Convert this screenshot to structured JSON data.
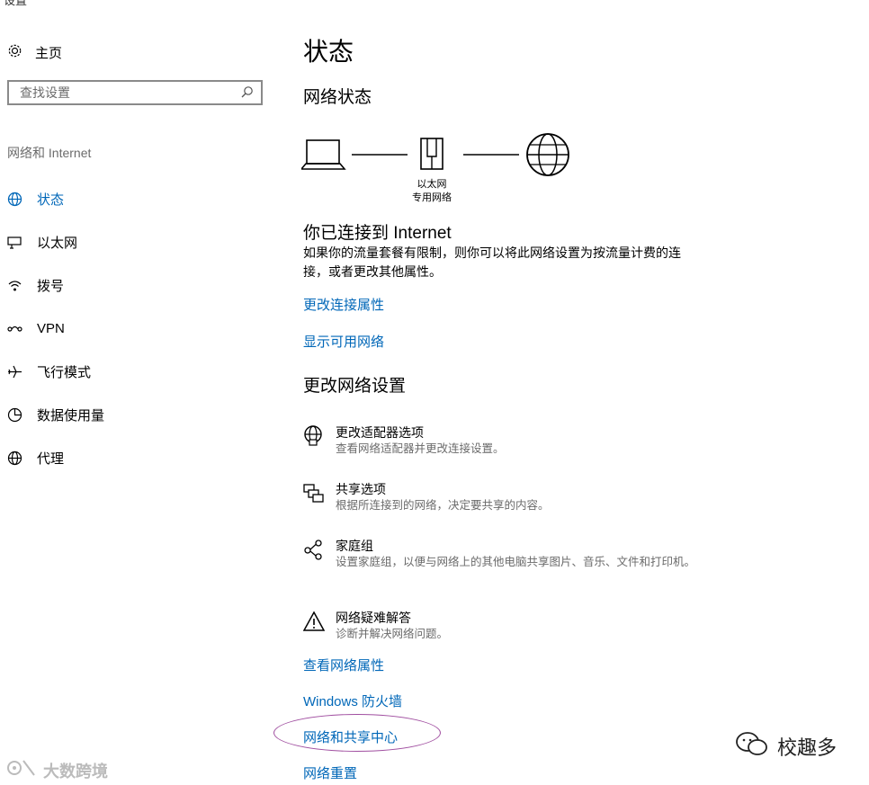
{
  "window": {
    "title": "设置"
  },
  "sidebar": {
    "home_label": "主页",
    "search_placeholder": "查找设置",
    "section_label": "网络和 Internet",
    "items": [
      {
        "label": "状态",
        "icon": "globe-status-icon",
        "active": true
      },
      {
        "label": "以太网",
        "icon": "ethernet-icon"
      },
      {
        "label": "拨号",
        "icon": "dialup-icon"
      },
      {
        "label": "VPN",
        "icon": "vpn-icon"
      },
      {
        "label": "飞行模式",
        "icon": "airplane-icon"
      },
      {
        "label": "数据使用量",
        "icon": "data-usage-icon"
      },
      {
        "label": "代理",
        "icon": "proxy-globe-icon"
      }
    ]
  },
  "main": {
    "title": "状态",
    "network_status_heading": "网络状态",
    "diagram": {
      "adapter_line1": "以太网",
      "adapter_line2": "专用网络"
    },
    "connected_heading": "你已连接到 Internet",
    "connected_desc": "如果你的流量套餐有限制，则你可以将此网络设置为按流量计费的连接，或者更改其他属性。",
    "links_top": [
      "更改连接属性",
      "显示可用网络"
    ],
    "change_heading": "更改网络设置",
    "options": [
      {
        "title": "更改适配器选项",
        "desc": "查看网络适配器并更改连接设置。",
        "icon": "adapter-icon"
      },
      {
        "title": "共享选项",
        "desc": "根据所连接到的网络，决定要共享的内容。",
        "icon": "sharing-icon"
      },
      {
        "title": "家庭组",
        "desc": "设置家庭组，以便与网络上的其他电脑共享图片、音乐、文件和打印机。",
        "icon": "homegroup-icon"
      },
      {
        "title": "网络疑难解答",
        "desc": "诊断并解决网络问题。",
        "icon": "warning-icon"
      }
    ],
    "links_bottom": [
      "查看网络属性",
      "Windows 防火墙",
      "网络和共享中心",
      "网络重置"
    ]
  },
  "watermarks": {
    "left": "大数跨境",
    "right": "校趣多"
  },
  "colors": {
    "accent": "#0067b8",
    "annotation": "#a04ea0"
  }
}
